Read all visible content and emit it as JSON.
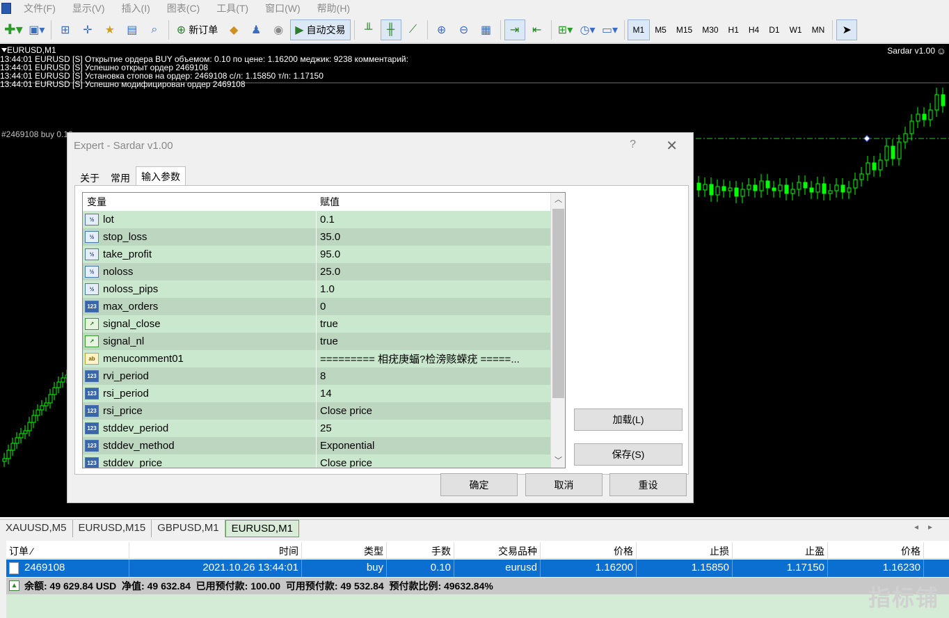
{
  "menu": [
    "文件(F)",
    "显示(V)",
    "插入(I)",
    "图表(C)",
    "工具(T)",
    "窗口(W)",
    "帮助(H)"
  ],
  "toolbar": {
    "new_order": "新订单",
    "auto_trade": "自动交易",
    "timeframes": [
      "M1",
      "M5",
      "M15",
      "M30",
      "H1",
      "H4",
      "D1",
      "W1",
      "MN"
    ],
    "active_timeframe": "M1"
  },
  "chart": {
    "title": "EURUSD,M1",
    "ea_label": "Sardar v1.00",
    "log": [
      "13:44:01 EURUSD [S] Открытие ордера BUY объемом: 0.10 по цене: 1.16200 меджик: 9238 комментарий:",
      "13:44:01 EURUSD [S] Успешно открыт ордер 2469108",
      "13:44:01 EURUSD [S] Установка стопов на ордер: 2469108 с/л: 1.15850 т/п: 1.17150",
      "13:44:01 EURUSD [S] Успешно модифицирован ордер 2469108"
    ],
    "order_label": "#2469108 buy 0.10"
  },
  "dialog": {
    "title": "Expert - Sardar v1.00",
    "help": "?",
    "close": "✕",
    "tabs": [
      "关于",
      "常用",
      "输入参数"
    ],
    "active_tab": 2,
    "grid_headers": [
      "变量",
      "赋值"
    ],
    "params": [
      {
        "type": "dbl",
        "name": "lot",
        "value": "0.1"
      },
      {
        "type": "dbl",
        "name": "stop_loss",
        "value": "35.0"
      },
      {
        "type": "dbl",
        "name": "take_profit",
        "value": "95.0"
      },
      {
        "type": "dbl",
        "name": "noloss",
        "value": "25.0"
      },
      {
        "type": "dbl",
        "name": "noloss_pips",
        "value": "1.0"
      },
      {
        "type": "int",
        "name": "max_orders",
        "value": "0"
      },
      {
        "type": "bool",
        "name": "signal_close",
        "value": "true"
      },
      {
        "type": "bool",
        "name": "signal_nl",
        "value": "true"
      },
      {
        "type": "str",
        "name": "menucomment01",
        "value": "========= 相疣庚蝠?检滂赅蝾疣 =====..."
      },
      {
        "type": "int",
        "name": "rvi_period",
        "value": "8"
      },
      {
        "type": "int",
        "name": "rsi_period",
        "value": "14"
      },
      {
        "type": "int",
        "name": "rsi_price",
        "value": "Close price"
      },
      {
        "type": "int",
        "name": "stddev_period",
        "value": "25"
      },
      {
        "type": "int",
        "name": "stddev_method",
        "value": "Exponential"
      },
      {
        "type": "int",
        "name": "stddev_price",
        "value": "Close price"
      }
    ],
    "type_icons": {
      "dbl": "½",
      "int": "123",
      "bool": "↗",
      "str": "ab"
    },
    "load_button": "加载(L)",
    "save_button": "保存(S)",
    "ok_button": "确定",
    "cancel_button": "取消",
    "reset_button": "重设"
  },
  "chart_tabs": [
    "XAUUSD,M5",
    "EURUSD,M15",
    "GBPUSD,M1",
    "EURUSD,M1"
  ],
  "active_chart_tab": 3,
  "terminal": {
    "headers": [
      "订单 ⁄",
      "时间",
      "类型",
      "手数",
      "交易品种",
      "价格",
      "止损",
      "止盈",
      "价格"
    ],
    "order": {
      "id": "2469108",
      "time": "2021.10.26 13:44:01",
      "type": "buy",
      "lots": "0.10",
      "symbol": "eurusd",
      "price": "1.16200",
      "sl": "1.15850",
      "tp": "1.17150",
      "current": "1.16230"
    },
    "balance_line": "余额: 49 629.84 USD  净值: 49 632.84  已用预付款: 100.00  可用预付款: 49 532.84  预付款比例: 49632.84%"
  },
  "watermark": "指标铺",
  "colors": {
    "chart_bg": "#000000",
    "candle": "#00ff00",
    "row_odd": "#c9e8cd",
    "row_even": "#bcd6c0",
    "selected": "#0a6fd0"
  }
}
